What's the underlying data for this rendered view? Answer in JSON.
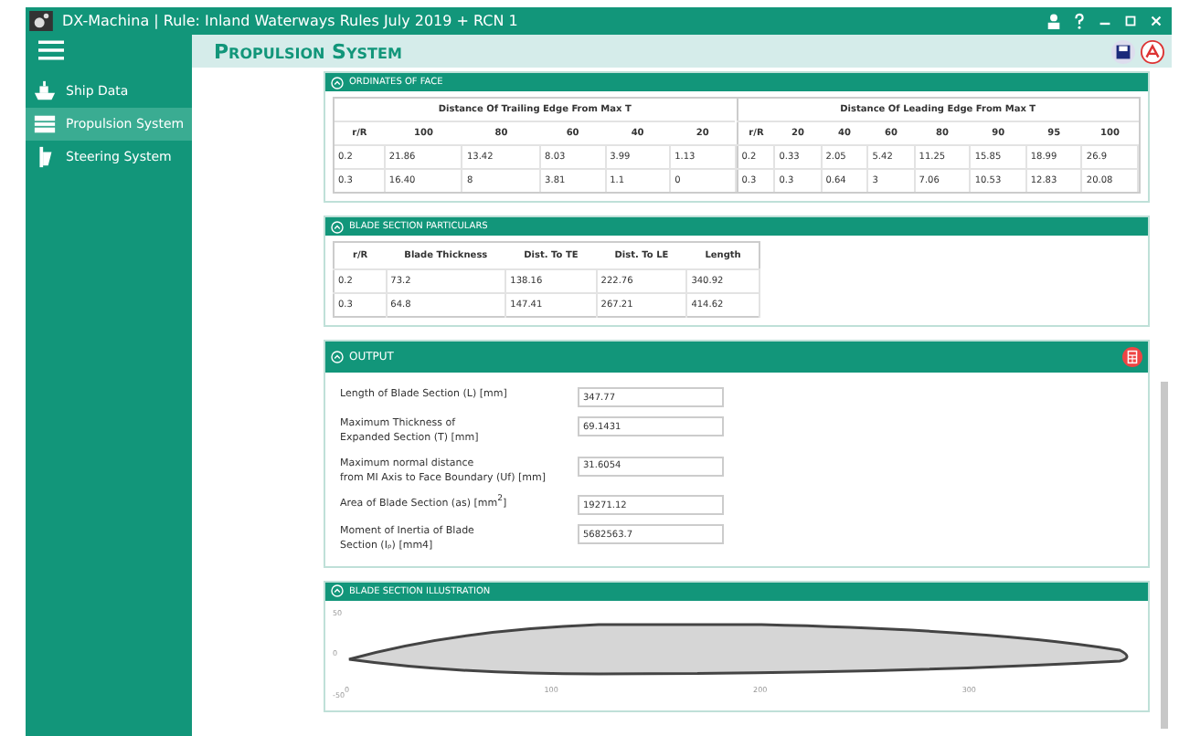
{
  "window": {
    "title": "DX-Machina | Rule: Inland Waterways Rules July 2019 + RCN 1"
  },
  "sidebar": {
    "items": [
      {
        "label": "Ship Data",
        "kind": "ship",
        "selected": false
      },
      {
        "label": "Propulsion System",
        "kind": "propeller",
        "selected": true
      },
      {
        "label": "Steering System",
        "kind": "rudder",
        "selected": false
      }
    ]
  },
  "page": {
    "title": "Propulsion System"
  },
  "ordinates": {
    "title": "ORDINATES OF FACE",
    "groups": [
      {
        "title": "Distance Of  Trailing Edge From Max T",
        "columns": [
          "r/R",
          "100",
          "80",
          "60",
          "40",
          "20"
        ],
        "rows": [
          [
            "0.2",
            "21.86",
            "13.42",
            "8.03",
            "3.99",
            "1.13"
          ],
          [
            "0.3",
            "16.40",
            "8",
            "3.81",
            "1.1",
            "0"
          ]
        ]
      },
      {
        "title": "Distance Of Leading Edge From Max T",
        "columns": [
          "r/R",
          "20",
          "40",
          "60",
          "80",
          "90",
          "95",
          "100"
        ],
        "rows": [
          [
            "0.2",
            "0.33",
            "2.05",
            "5.42",
            "11.25",
            "15.85",
            "18.99",
            "26.9"
          ],
          [
            "0.3",
            "0.3",
            "0.64",
            "3",
            "7.06",
            "10.53",
            "12.83",
            "20.08"
          ]
        ]
      }
    ]
  },
  "particulars": {
    "title": "BLADE SECTION PARTICULARS",
    "columns": [
      "r/R",
      "Blade Thickness",
      "Dist. To TE",
      "Dist. To LE",
      "Length"
    ],
    "rows": [
      [
        "0.2",
        "73.2",
        "138.16",
        "222.76",
        "340.92"
      ],
      [
        "0.3",
        "64.8",
        "147.41",
        "267.21",
        "414.62"
      ]
    ]
  },
  "output": {
    "title": "OUTPUT",
    "fields": [
      {
        "label": "Length of Blade Section (L) [mm]",
        "value": "347.77"
      },
      {
        "label": "Maximum Thickness of\nExpanded Section (T) [mm]",
        "value": "69.1431"
      },
      {
        "label": "Maximum normal distance\nfrom MI Axis to Face  Boundary (Uf) [mm]",
        "value": "31.6054"
      },
      {
        "label": "Area of Blade Section (as) [mm$^{2}$]",
        "value": "19271.12"
      },
      {
        "label": "Moment of Inertia of Blade\nSection (Iₚ) [mm4]",
        "value": "5682563.7"
      }
    ]
  },
  "illustration": {
    "title": "BLADE SECTION ILLUSTRATION",
    "yticks": [
      "50",
      "0",
      "-50"
    ],
    "xticks": [
      "0",
      "100",
      "200",
      "300"
    ]
  }
}
